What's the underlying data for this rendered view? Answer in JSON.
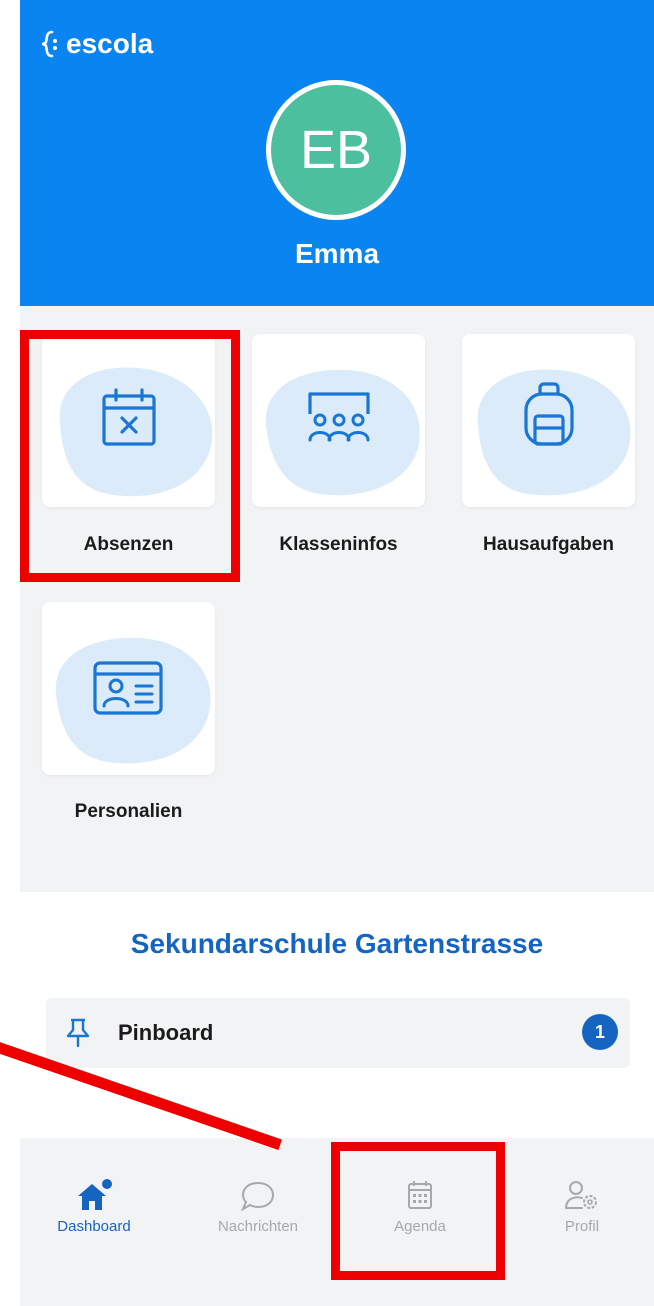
{
  "app": {
    "brand": "escola"
  },
  "user": {
    "initials": "EB",
    "name": "Emma"
  },
  "tiles": [
    {
      "label": "Absenzen",
      "icon": "calendar-x-icon"
    },
    {
      "label": "Klasseninfos",
      "icon": "class-group-icon"
    },
    {
      "label": "Hausaufgaben",
      "icon": "backpack-icon"
    },
    {
      "label": "Personalien",
      "icon": "id-card-icon"
    }
  ],
  "school": {
    "name": "Sekundarschule Gartenstrasse"
  },
  "pinboard": {
    "label": "Pinboard",
    "count": "1",
    "icon": "pin-icon"
  },
  "nav": {
    "items": [
      {
        "label": "Dashboard",
        "icon": "home-icon",
        "active": true
      },
      {
        "label": "Nachrichten",
        "icon": "chat-bubble-icon",
        "active": false
      },
      {
        "label": "Agenda",
        "icon": "calendar-icon",
        "active": false
      },
      {
        "label": "Profil",
        "icon": "profile-settings-icon",
        "active": false
      }
    ]
  },
  "colors": {
    "header": "#0a84f0",
    "avatar": "#4cbf9e",
    "accent": "#1565c0",
    "tile_blob": "#dcebfa",
    "icon": "#1976d2",
    "annotation": "#ee0000"
  }
}
